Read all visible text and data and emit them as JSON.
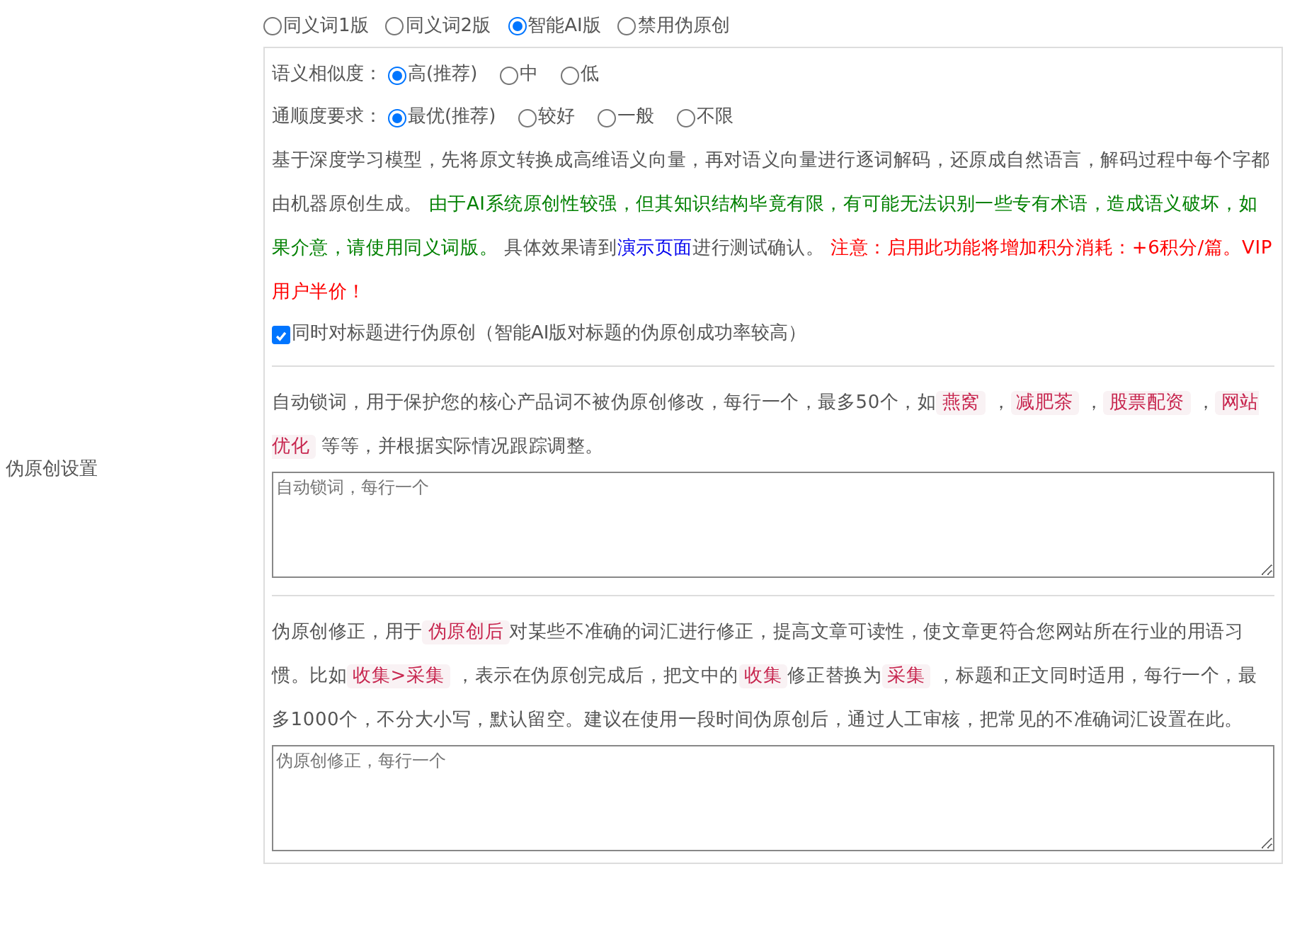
{
  "sidebar_label": "伪原创设置",
  "modes": [
    {
      "label": "同义词1版",
      "selected": false
    },
    {
      "label": "同义词2版",
      "selected": false
    },
    {
      "label": "智能AI版",
      "selected": true
    },
    {
      "label": "禁用伪原创",
      "selected": false
    }
  ],
  "settings": [
    {
      "label": "语义相似度：",
      "options": [
        {
          "label": "高(推荐)",
          "selected": true
        },
        {
          "label": "中",
          "selected": false
        },
        {
          "label": "低",
          "selected": false
        }
      ]
    },
    {
      "label": "通顺度要求：",
      "options": [
        {
          "label": "最优(推荐)",
          "selected": true
        },
        {
          "label": "较好",
          "selected": false
        },
        {
          "label": "一般",
          "selected": false
        },
        {
          "label": "不限",
          "selected": false
        }
      ]
    }
  ],
  "description": [
    {
      "kind": "plain",
      "text": "基于深度学习模型，先将原文转换成高维语义向量，再对语义向量进行逐词解码，还原成自然语言，解码过程中每个字都由机器原创生成。 "
    },
    {
      "kind": "green",
      "text": "由于AI系统原创性较强，但其知识结构毕竟有限，有可能无法识别一些专有术语，造成语义破坏，如果介意，请使用同义词版。"
    },
    {
      "kind": "plain",
      "text": " 具体效果请到"
    },
    {
      "kind": "link",
      "text": "演示页面"
    },
    {
      "kind": "plain",
      "text": "进行测试确认。 "
    },
    {
      "kind": "red",
      "text": "注意：启用此功能将增加积分消耗：+6积分/篇。VIP用户半价！"
    }
  ],
  "title_option": {
    "label": "同时对标题进行伪原创（智能AI版对标题的伪原创成功率较高）",
    "checked": true
  },
  "lock_words": {
    "description": [
      {
        "kind": "plain",
        "text": "自动锁词，用于保护您的核心产品词不被伪原创修改，每行一个，最多50个，如"
      },
      {
        "kind": "code",
        "text": "燕窝"
      },
      {
        "kind": "plain",
        "text": " ，"
      },
      {
        "kind": "code",
        "text": "减肥茶"
      },
      {
        "kind": "plain",
        "text": " ，"
      },
      {
        "kind": "code",
        "text": "股票配资"
      },
      {
        "kind": "plain",
        "text": " ，"
      },
      {
        "kind": "code",
        "text": "网站优化"
      },
      {
        "kind": "plain",
        "text": " 等等，并根据实际情况跟踪调整。"
      }
    ],
    "placeholder": "自动锁词，每行一个"
  },
  "correction": {
    "description": [
      {
        "kind": "plain",
        "text": "伪原创修正，用于"
      },
      {
        "kind": "code",
        "text": "伪原创后"
      },
      {
        "kind": "plain",
        "text": "对某些不准确的词汇进行修正，提高文章可读性，使文章更符合您网站所在行业的用语习惯。比如"
      },
      {
        "kind": "code",
        "text": "收集>采集"
      },
      {
        "kind": "plain",
        "text": " ，表示在伪原创完成后，把文中的"
      },
      {
        "kind": "code",
        "text": "收集"
      },
      {
        "kind": "plain",
        "text": "修正替换为"
      },
      {
        "kind": "code",
        "text": "采集"
      },
      {
        "kind": "plain",
        "text": " ，标题和正文同时适用，每行一个，最多1000个，不分大小写，默认留空。建议在使用一段时间伪原创后，通过人工审核，把常见的不准确词汇设置在此。"
      }
    ],
    "placeholder": "伪原创修正，每行一个"
  }
}
